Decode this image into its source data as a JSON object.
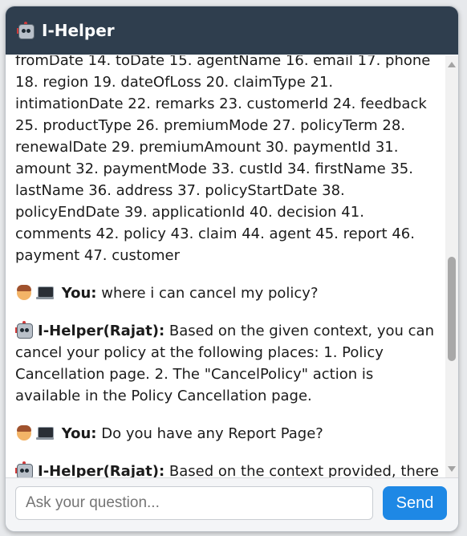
{
  "header": {
    "title": "I-Helper",
    "icon": "robot-icon"
  },
  "messages": [
    {
      "speaker": "",
      "text": "fromDate 14. toDate 15. agentName 16. email 17. phone 18. region 19. dateOfLoss 20. claimType 21. intimationDate 22. remarks 23. customerId 24. feedback 25. productType 26. premiumMode 27. policyTerm 28. renewalDate 29. premiumAmount 30. paymentId 31. amount 32. paymentMode 33. custId 34. firstName 35. lastName 36. address 37. policyStartDate 38. policyEndDate 39. applicationId 40. decision 41. comments 42. policy 43. claim 44. agent 45. report 46. payment 47. customer"
    },
    {
      "speaker": "You:",
      "text": "where i can cancel my policy?"
    },
    {
      "speaker": "I-Helper(Rajat):",
      "text": "Based on the given context, you can cancel your policy at the following places: 1. Policy Cancellation page. 2. The \"CancelPolicy\" action is available in the Policy Cancellation page."
    },
    {
      "speaker": "You:",
      "text": "Do you have any Report Page?"
    },
    {
      "speaker": "I-Helper(Rajat):",
      "text": "Based on the context provided, there"
    }
  ],
  "input": {
    "placeholder": "Ask your question..."
  },
  "send_label": "Send"
}
